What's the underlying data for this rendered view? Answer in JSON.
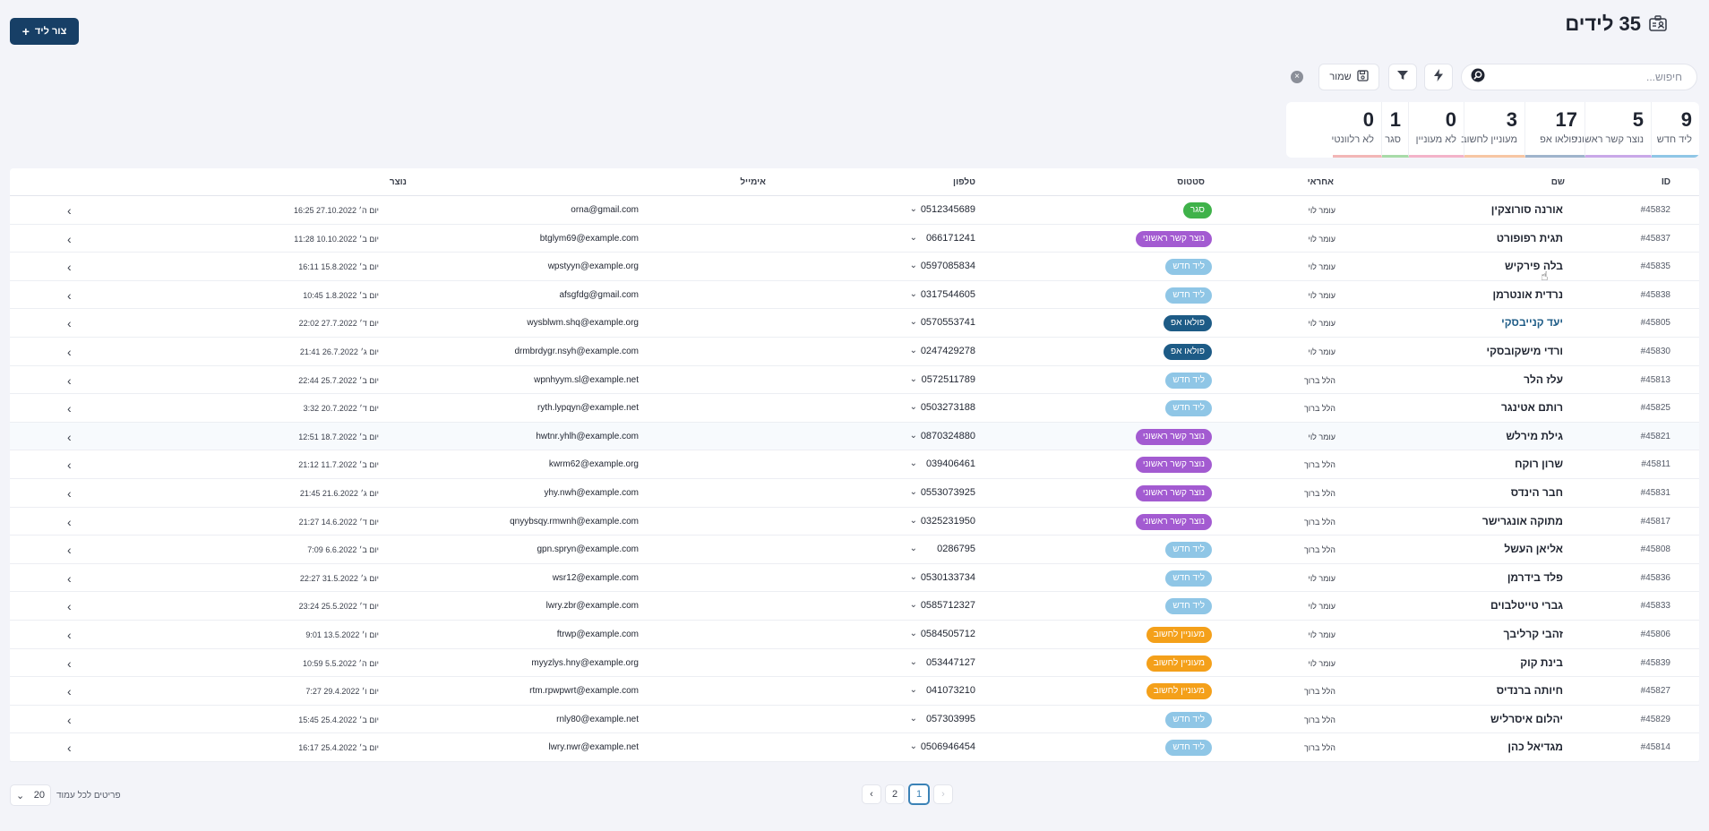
{
  "header": {
    "title": "35 לידים",
    "create_label": "צור ליד"
  },
  "toolbar": {
    "search_placeholder": "חיפוש...",
    "save_label": "שמור"
  },
  "colors": {
    "primary": "#173f66",
    "status_new": "#8fc6e6",
    "status_contacted": "#a35bd1",
    "status_followup": "#1d5b86",
    "status_interested": "#f4a01a",
    "status_filtered": "#3fb24a"
  },
  "stats": [
    {
      "num": "9",
      "label": "ליד חדש",
      "color": "#8fc6e6"
    },
    {
      "num": "5",
      "label": "נוצר קשר ראשוני",
      "color": "#c9a8e8"
    },
    {
      "num": "17",
      "label": "פולאו אפ",
      "color": "#9fb4cc"
    },
    {
      "num": "3",
      "label": "מעוניין לחשוב",
      "color": "#f7c6a3"
    },
    {
      "num": "0",
      "label": "לא מעוניין",
      "color": "#f3b3c9"
    },
    {
      "num": "1",
      "label": "סגר",
      "color": "#a8dba8"
    },
    {
      "num": "0",
      "label": "לא רלוונטי",
      "color": "#f2b6b6"
    }
  ],
  "table": {
    "headers": {
      "id": "ID",
      "name": "שם",
      "owner": "אחראי",
      "status": "סטטוס",
      "phone": "טלפון",
      "email": "אימייל",
      "created": "נוצר"
    },
    "rows": [
      {
        "id": "#45832",
        "name": "אורנה סורוצקין",
        "owner": "עומר לוי",
        "status": "סגר",
        "status_key": "filtered",
        "phone": "0512345689",
        "email": "orna@gmail.com",
        "created": "יום ה׳ 27.10.2022 16:25"
      },
      {
        "id": "#45837",
        "name": "תגית רפופורט",
        "owner": "עומר לוי",
        "status": "נוצר קשר ראשוני",
        "status_key": "contacted",
        "phone": "066171241",
        "email": "btglym69@example.com",
        "created": "יום ב׳ 10.10.2022 11:28"
      },
      {
        "id": "#45835",
        "name": "בלה פירקיש",
        "owner": "עומר לוי",
        "status": "ליד חדש",
        "status_key": "new",
        "phone": "0597085834",
        "email": "wpstyyn@example.org",
        "created": "יום ב׳ 15.8.2022 16:11"
      },
      {
        "id": "#45838",
        "name": "נרדית אונטרמן",
        "owner": "עומר לוי",
        "status": "ליד חדש",
        "status_key": "new",
        "phone": "0317544605",
        "email": "afsgfdg@gmail.com",
        "created": "יום ב׳ 1.8.2022 10:45"
      },
      {
        "id": "#45805",
        "name": "יעד קנייבסקי",
        "owner": "עומר לוי",
        "status": "פולאו אפ",
        "status_key": "followup",
        "phone": "0570553741",
        "email": "wysblwm.shq@example.org",
        "created": "יום ד׳ 27.7.2022 22:02",
        "link": true
      },
      {
        "id": "#45830",
        "name": "ורדי מישקובסקי",
        "owner": "עומר לוי",
        "status": "פולאו אפ",
        "status_key": "followup",
        "phone": "0247429278",
        "email": "drmbrdygr.nsyh@example.com",
        "created": "יום ג׳ 26.7.2022 21:41"
      },
      {
        "id": "#45813",
        "name": "עלז הלר",
        "owner": "הלל ברוך",
        "status": "ליד חדש",
        "status_key": "new",
        "phone": "0572511789",
        "email": "wpnhyym.sl@example.net",
        "created": "יום ב׳ 25.7.2022 22:44"
      },
      {
        "id": "#45825",
        "name": "רותם אטינגר",
        "owner": "הלל ברוך",
        "status": "ליד חדש",
        "status_key": "new",
        "phone": "0503273188",
        "email": "ryth.lypqyn@example.net",
        "created": "יום ד׳ 20.7.2022 3:32"
      },
      {
        "id": "#45821",
        "name": "גילת מירלש",
        "owner": "עומר לוי",
        "status": "נוצר קשר ראשוני",
        "status_key": "contacted",
        "phone": "0870324880",
        "email": "hwtnr.yhlh@example.com",
        "created": "יום ב׳ 18.7.2022 12:51",
        "hl": true
      },
      {
        "id": "#45811",
        "name": "שרון רוקח",
        "owner": "הלל ברוך",
        "status": "נוצר קשר ראשוני",
        "status_key": "contacted",
        "phone": "039406461",
        "email": "kwrm62@example.org",
        "created": "יום ב׳ 11.7.2022 21:12"
      },
      {
        "id": "#45831",
        "name": "חבר הינדס",
        "owner": "הלל ברוך",
        "status": "נוצר קשר ראשוני",
        "status_key": "contacted",
        "phone": "0553073925",
        "email": "yhy.nwh@example.com",
        "created": "יום ג׳ 21.6.2022 21:45"
      },
      {
        "id": "#45817",
        "name": "מתוקה אונגרישר",
        "owner": "הלל ברוך",
        "status": "נוצר קשר ראשוני",
        "status_key": "contacted",
        "phone": "0325231950",
        "email": "qnyybsqy.rmwnh@example.com",
        "created": "יום ד׳ 14.6.2022 21:27"
      },
      {
        "id": "#45808",
        "name": "אליאן העשל",
        "owner": "הלל ברוך",
        "status": "ליד חדש",
        "status_key": "new",
        "phone": "0286795",
        "email": "gpn.spryn@example.com",
        "created": "יום ב׳ 6.6.2022 7:09"
      },
      {
        "id": "#45836",
        "name": "פלד בידרמן",
        "owner": "עומר לוי",
        "status": "ליד חדש",
        "status_key": "new",
        "phone": "0530133734",
        "email": "wsr12@example.com",
        "created": "יום ג׳ 31.5.2022 22:27"
      },
      {
        "id": "#45833",
        "name": "גברי טייטלבוים",
        "owner": "עומר לוי",
        "status": "ליד חדש",
        "status_key": "new",
        "phone": "0585712327",
        "email": "lwry.zbr@example.com",
        "created": "יום ד׳ 25.5.2022 23:24"
      },
      {
        "id": "#45806",
        "name": "זהבי קרליבך",
        "owner": "עומר לוי",
        "status": "מעוניין לחשוב",
        "status_key": "interested",
        "phone": "0584505712",
        "email": "ftrwp@example.com",
        "created": "יום ו׳ 13.5.2022 9:01"
      },
      {
        "id": "#45839",
        "name": "בינת קוק",
        "owner": "עומר לוי",
        "status": "מעוניין לחשוב",
        "status_key": "interested",
        "phone": "053447127",
        "email": "myyzlys.hny@example.org",
        "created": "יום ה׳ 5.5.2022 10:59"
      },
      {
        "id": "#45827",
        "name": "חיותה ברנדיס",
        "owner": "הלל ברוך",
        "status": "מעוניין לחשוב",
        "status_key": "interested",
        "phone": "041073210",
        "email": "rtm.rpwpwrt@example.com",
        "created": "יום ו׳ 29.4.2022 7:27"
      },
      {
        "id": "#45829",
        "name": "יהלום איסרליש",
        "owner": "הלל ברוך",
        "status": "ליד חדש",
        "status_key": "new",
        "phone": "057303995",
        "email": "rnly80@example.net",
        "created": "יום ב׳ 25.4.2022 15:45"
      },
      {
        "id": "#45814",
        "name": "מגדיאל כהן",
        "owner": "הלל ברוך",
        "status": "ליד חדש",
        "status_key": "new",
        "phone": "0506946454",
        "email": "lwry.nwr@example.net",
        "created": "יום ב׳ 25.4.2022 16:17"
      }
    ]
  },
  "pagination": {
    "pages": [
      "2",
      "1"
    ],
    "current": "1"
  },
  "per_page": {
    "value": "20",
    "label": "פריטים לכל עמוד"
  }
}
